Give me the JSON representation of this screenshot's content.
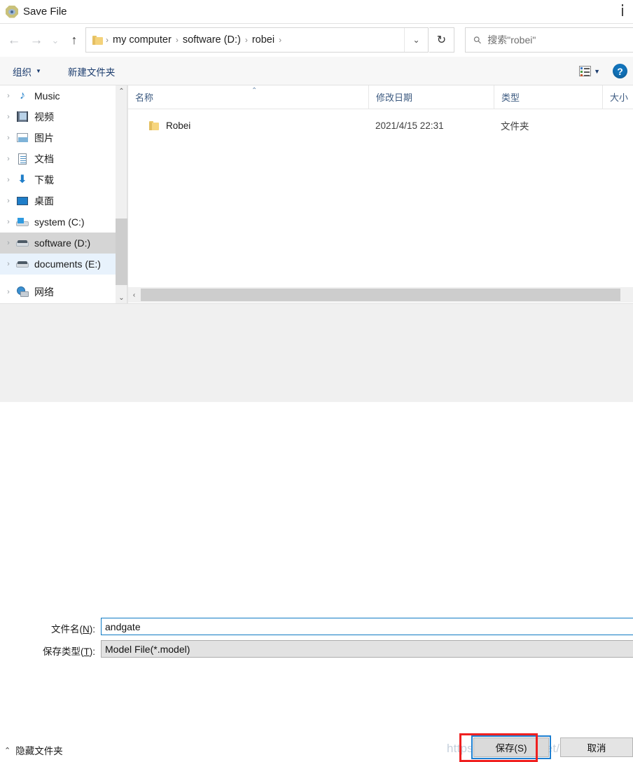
{
  "window": {
    "title": "Save File",
    "icon": "app-diamond-icon",
    "close_label": "⋮"
  },
  "nav": {
    "back_icon": "←",
    "forward_icon": "→",
    "recent_icon": "⌄",
    "up_icon": "↑",
    "refresh_icon": "↻",
    "dropdown_icon": "⌄",
    "breadcrumbs": [
      {
        "label": "my computer"
      },
      {
        "label": "software (D:)"
      },
      {
        "label": "robei"
      }
    ],
    "separator": "›"
  },
  "search": {
    "icon": "search-icon",
    "glyph": "⚲",
    "text": "搜索\"robei\""
  },
  "toolbar": {
    "organize_label": "组织",
    "organize_caret": "▼",
    "new_folder_label": "新建文件夹",
    "view_caret": "▼",
    "help_label": "?"
  },
  "sidebar": {
    "items": [
      {
        "label": "Music",
        "icon": "music-icon",
        "expander": "›",
        "state": "normal"
      },
      {
        "label": "视频",
        "icon": "videos-icon",
        "expander": "›",
        "state": "normal"
      },
      {
        "label": "图片",
        "icon": "pictures-icon",
        "expander": "›",
        "state": "normal"
      },
      {
        "label": "文档",
        "icon": "documents-icon",
        "expander": "›",
        "state": "normal"
      },
      {
        "label": "下载",
        "icon": "downloads-icon",
        "expander": "›",
        "state": "normal"
      },
      {
        "label": "桌面",
        "icon": "desktop-icon",
        "expander": "›",
        "state": "normal"
      },
      {
        "label": "system (C:)",
        "icon": "windows-drive-icon",
        "expander": "›",
        "state": "normal"
      },
      {
        "label": "software (D:)",
        "icon": "drive-icon",
        "expander": "›",
        "state": "selected"
      },
      {
        "label": "documents (E:)",
        "icon": "drive-icon",
        "expander": "›",
        "state": "hover"
      },
      {
        "label": "网络",
        "icon": "network-icon",
        "expander": "›",
        "state": "normal"
      }
    ],
    "scroll_up": "⌃",
    "scroll_down": "⌄"
  },
  "filelist": {
    "columns": [
      {
        "label": "名称"
      },
      {
        "label": "修改日期"
      },
      {
        "label": "类型"
      },
      {
        "label": "大小"
      }
    ],
    "sort_arrow": "⌃",
    "rows": [
      {
        "name": "Robei",
        "modified": "2021/4/15 22:31",
        "type": "文件夹",
        "size": ""
      }
    ],
    "hscroll_left": "‹"
  },
  "form": {
    "filename_label_pre": "文件名(",
    "filename_label_key": "N",
    "filename_label_post": "):",
    "filename_value": "andgate",
    "filetype_label_pre": "保存类型(",
    "filetype_label_key": "T",
    "filetype_label_post": "):",
    "filetype_value": "Model File(*.model)"
  },
  "footer": {
    "hide_folders_caret": "⌃",
    "hide_folders_label": "隐藏文件夹",
    "save_label": "保存(S)",
    "cancel_label": "取消",
    "watermark": "https://blog.csdn.net/QWERzxw"
  },
  "colors": {
    "accent": "#0f7bc4",
    "annotation": "#ef2020",
    "selection": "#d5d5d5",
    "hover": "#e8f2fc",
    "toolbar_link": "#1b3c6e"
  }
}
